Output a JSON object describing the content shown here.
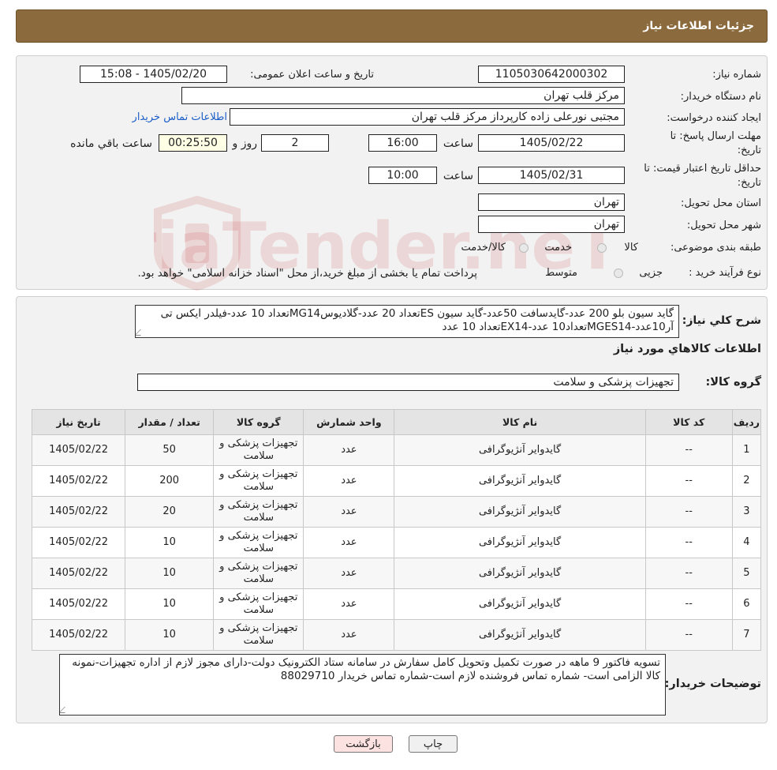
{
  "header": {
    "title": "جزئیات اطلاعات نیاز"
  },
  "watermark": {
    "text": "AriaTender.neT"
  },
  "form": {
    "need_number_label": "شماره نیاز:",
    "need_number": "1105030642000302",
    "announce_label": "تاریخ و ساعت اعلان عمومی:",
    "announce_value": "1405/02/20 - 15:08",
    "buyer_org_label": "نام دستگاه خریدار:",
    "buyer_org": "مرکز قلب تهران",
    "creator_label": "ایجاد کننده درخواست:",
    "creator": "مجتبی نورعلی زاده کارپرداز مرکز قلب تهران",
    "contact_link": "اطلاعات تماس خریدار",
    "deadline_label_1": "مهلت ارسال پاسخ: تا",
    "deadline_label_2": "تاریخ:",
    "deadline_date": "1405/02/22",
    "time_label": "ساعت",
    "deadline_time": "16:00",
    "days_value": "2",
    "days_label": "روز و",
    "remaining_time": "00:25:50",
    "remaining_label": "ساعت باقي مانده",
    "validity_label_1": "حداقل تاریخ اعتبار قیمت: تا",
    "validity_label_2": "تاریخ:",
    "validity_date": "1405/02/31",
    "validity_time": "10:00",
    "province_label": "استان محل تحویل:",
    "province": "تهران",
    "city_label": "شهر محل تحویل:",
    "city": "تهران",
    "category_label": "طبقه بندی موضوعی:",
    "category_options": [
      "کالا",
      "خدمت",
      "کالا/خدمت"
    ],
    "process_label": "نوع فرآیند خرید :",
    "process_options": [
      "جزیی",
      "متوسط"
    ],
    "process_note": "پرداخت تمام یا بخشی از مبلغ خرید،از محل \"اسناد خزانه اسلامی\" خواهد بود."
  },
  "summary": {
    "label": "شرح کلي نياز:",
    "text": "گاید سیون بلو 200 عدد-گایدسافت 50عدد-گاید سیون ESتعداد 20 عدد-گلادیوسMG14تعداد 10 عدد-فیلدر ایکس تی آر10عدد-MGES14تعداد10 عدد-EX14تعداد 10 عدد",
    "goods_info_title": "اطلاعات کالاهاي مورد نياز",
    "group_label": "گروه کالا:",
    "group_value": "تجهیزات پزشکی و سلامت"
  },
  "table": {
    "headers": [
      "ردیف",
      "کد کالا",
      "نام کالا",
      "واحد شمارش",
      "گروه کالا",
      "تعداد / مقدار",
      "تاریخ نیاز"
    ],
    "rows": [
      [
        "1",
        "--",
        "گایدوایر آنژیوگرافی",
        "عدد",
        "تجهیزات پزشکی و سلامت",
        "50",
        "1405/02/22"
      ],
      [
        "2",
        "--",
        "گایدوایر آنژیوگرافی",
        "عدد",
        "تجهیزات پزشکی و سلامت",
        "200",
        "1405/02/22"
      ],
      [
        "3",
        "--",
        "گایدوایر آنژیوگرافی",
        "عدد",
        "تجهیزات پزشکی و سلامت",
        "20",
        "1405/02/22"
      ],
      [
        "4",
        "--",
        "گایدوایر آنژیوگرافی",
        "عدد",
        "تجهیزات پزشکی و سلامت",
        "10",
        "1405/02/22"
      ],
      [
        "5",
        "--",
        "گایدوایر آنژیوگرافی",
        "عدد",
        "تجهیزات پزشکی و سلامت",
        "10",
        "1405/02/22"
      ],
      [
        "6",
        "--",
        "گایدوایر آنژیوگرافی",
        "عدد",
        "تجهیزات پزشکی و سلامت",
        "10",
        "1405/02/22"
      ],
      [
        "7",
        "--",
        "گایدوایر آنژیوگرافی",
        "عدد",
        "تجهیزات پزشکی و سلامت",
        "10",
        "1405/02/22"
      ]
    ]
  },
  "buyer_notes": {
    "label": "توضیحات خریدار:",
    "text": "تسویه فاکتور 9 ماهه در صورت تکمیل وتحویل کامل سفارش در سامانه  ستاد الکترونیک دولت-دارای مجوز لازم از اداره تجهیزات-نمونه کالا الزامی است- شماره تماس فروشنده لازم است-شماره تماس خریدار 88029710"
  },
  "buttons": {
    "print": "چاپ",
    "back": "بازگشت"
  },
  "colors": {
    "header_bg": "#8b6b3d",
    "link": "#1a5dc8",
    "back_button_bg": "#fde2e2"
  }
}
